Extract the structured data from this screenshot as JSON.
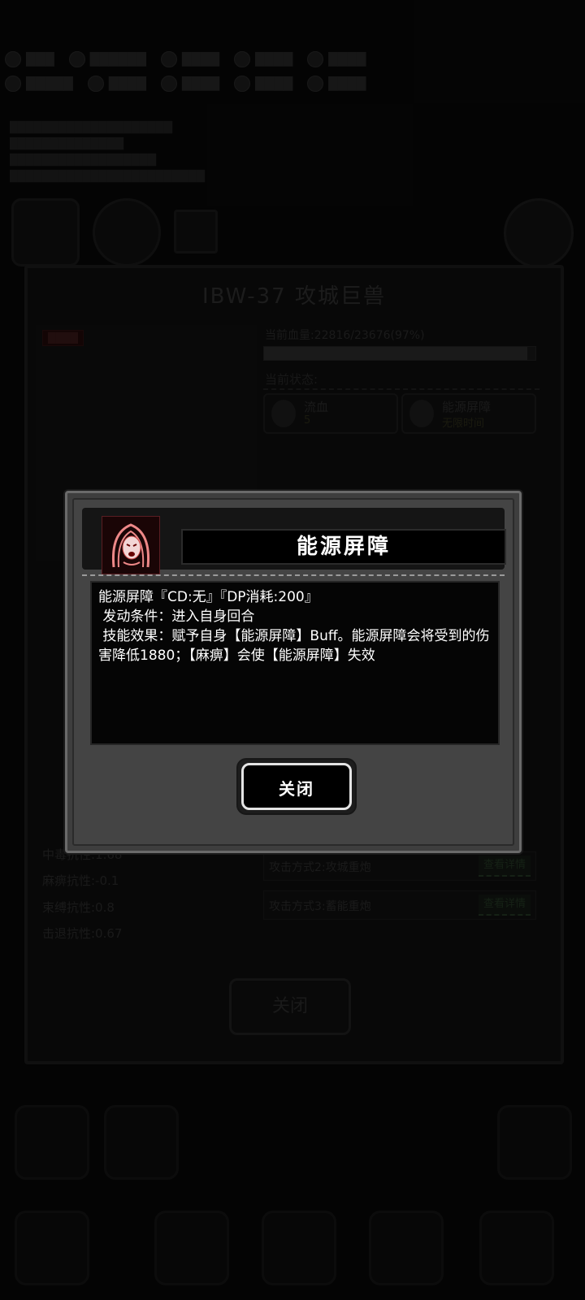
{
  "modal": {
    "title": "能源屏障",
    "description": {
      "line1": "能源屏障『CD:无』『DP消耗:200』",
      "line2": " 发动条件：进入自身回合",
      "line3": " 技能效果：赋予自身【能源屏障】Buff。能源屏障会将受到的伤害降低1880；【麻痹】会使【能源屏障】失效"
    },
    "close_label": "关闭"
  },
  "background": {
    "panel_title": "IBW-37 攻城巨兽",
    "hp_text": "当前血量:22816/23676(97%)",
    "hp_fraction": 0.97,
    "status_label": "当前状态:",
    "statuses": [
      {
        "name": "流血",
        "sub": "5",
        "icon": "blood-drop-icon"
      },
      {
        "name": "能源屏障",
        "sub": "无限时间",
        "icon": "energy-ring-icon"
      }
    ],
    "stats": [
      "中毒抗性:1.68",
      "麻痹抗性:-0.1",
      "束缚抗性:0.8",
      "击退抗性:0.67"
    ],
    "attacks": [
      {
        "label": "攻击方式2:攻城重炮",
        "button": "查看详情"
      },
      {
        "label": "攻击方式3:蓄能重炮",
        "button": "查看详情"
      }
    ],
    "panel_close_label": "关闭"
  }
}
